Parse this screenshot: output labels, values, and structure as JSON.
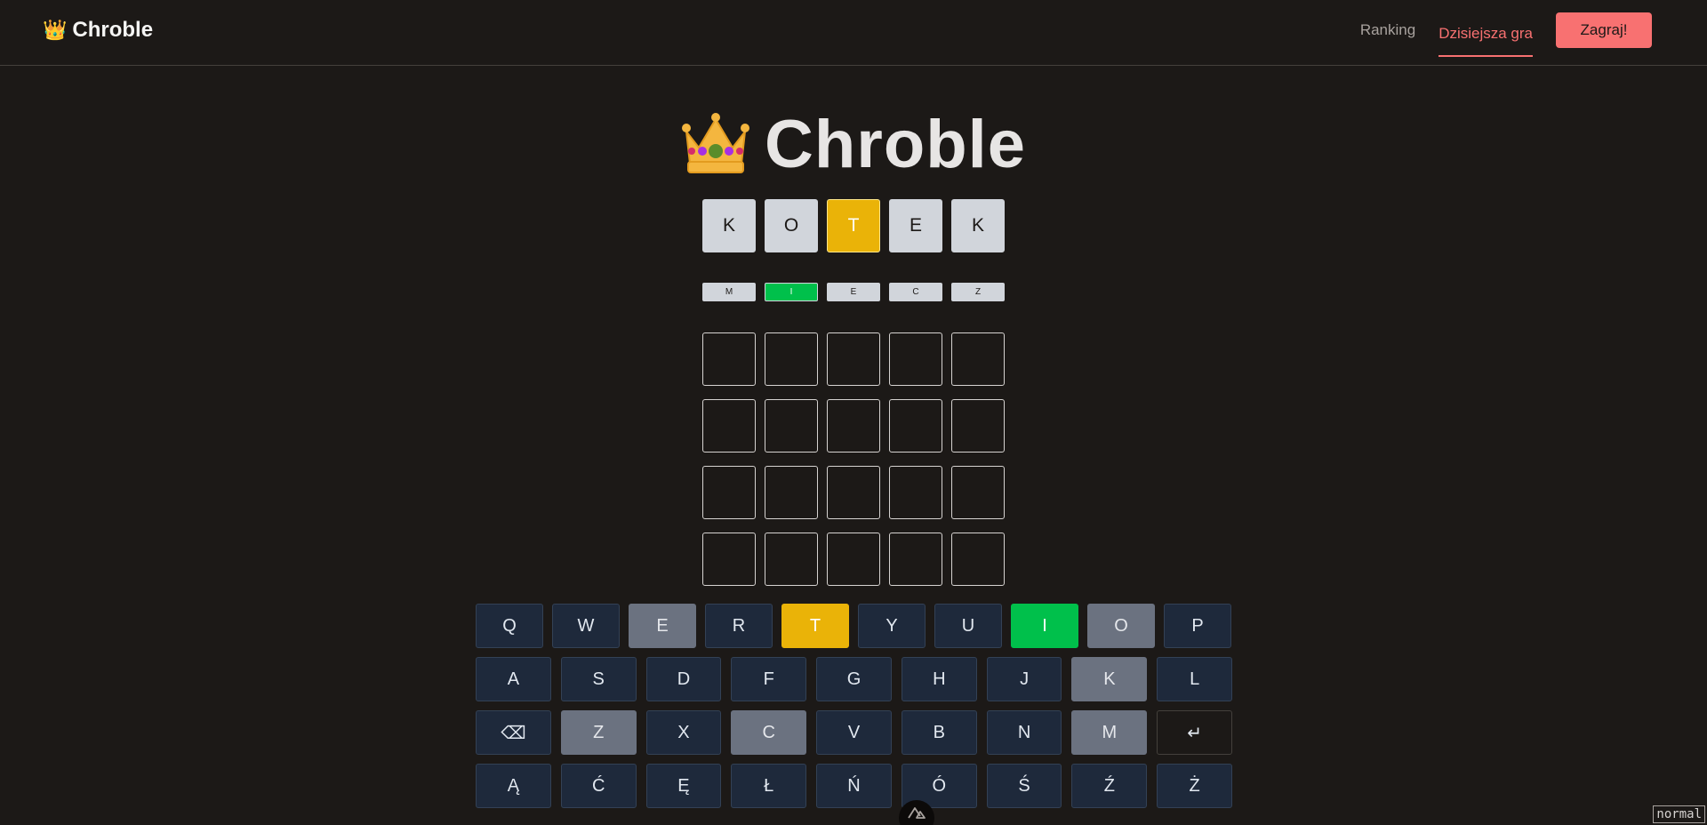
{
  "header": {
    "brand": "Chroble",
    "brand_icon": "crown-icon",
    "nav": [
      {
        "label": "Ranking",
        "active": false
      },
      {
        "label": "Dzisiejsza gra",
        "active": true
      }
    ],
    "play_button": "Zagraj!",
    "accent": "#f87171"
  },
  "title": "Chroble",
  "board": {
    "rows": [
      {
        "size": "large",
        "tiles": [
          {
            "letter": "K",
            "state": "absent"
          },
          {
            "letter": "O",
            "state": "absent"
          },
          {
            "letter": "T",
            "state": "present"
          },
          {
            "letter": "E",
            "state": "absent"
          },
          {
            "letter": "K",
            "state": "absent"
          }
        ]
      },
      {
        "size": "small",
        "tiles": [
          {
            "letter": "M",
            "state": "absent"
          },
          {
            "letter": "I",
            "state": "correct"
          },
          {
            "letter": "E",
            "state": "absent"
          },
          {
            "letter": "C",
            "state": "absent"
          },
          {
            "letter": "Z",
            "state": "absent"
          }
        ]
      },
      {
        "size": "large",
        "tiles": [
          {
            "letter": "",
            "state": "empty"
          },
          {
            "letter": "",
            "state": "empty"
          },
          {
            "letter": "",
            "state": "empty"
          },
          {
            "letter": "",
            "state": "empty"
          },
          {
            "letter": "",
            "state": "empty"
          }
        ]
      },
      {
        "size": "large",
        "tiles": [
          {
            "letter": "",
            "state": "empty"
          },
          {
            "letter": "",
            "state": "empty"
          },
          {
            "letter": "",
            "state": "empty"
          },
          {
            "letter": "",
            "state": "empty"
          },
          {
            "letter": "",
            "state": "empty"
          }
        ]
      },
      {
        "size": "large",
        "tiles": [
          {
            "letter": "",
            "state": "empty"
          },
          {
            "letter": "",
            "state": "empty"
          },
          {
            "letter": "",
            "state": "empty"
          },
          {
            "letter": "",
            "state": "empty"
          },
          {
            "letter": "",
            "state": "empty"
          }
        ]
      },
      {
        "size": "large",
        "tiles": [
          {
            "letter": "",
            "state": "empty"
          },
          {
            "letter": "",
            "state": "empty"
          },
          {
            "letter": "",
            "state": "empty"
          },
          {
            "letter": "",
            "state": "empty"
          },
          {
            "letter": "",
            "state": "empty"
          }
        ]
      }
    ],
    "colors": {
      "absent": "#d1d5db",
      "present": "#eab308",
      "correct": "#00c04b"
    }
  },
  "keyboard": {
    "rows": [
      [
        {
          "k": "Q",
          "s": ""
        },
        {
          "k": "W",
          "s": ""
        },
        {
          "k": "E",
          "s": "absent"
        },
        {
          "k": "R",
          "s": ""
        },
        {
          "k": "T",
          "s": "present"
        },
        {
          "k": "Y",
          "s": ""
        },
        {
          "k": "U",
          "s": ""
        },
        {
          "k": "I",
          "s": "correct"
        },
        {
          "k": "O",
          "s": "absent"
        },
        {
          "k": "P",
          "s": ""
        }
      ],
      [
        {
          "k": "A",
          "s": ""
        },
        {
          "k": "S",
          "s": ""
        },
        {
          "k": "D",
          "s": ""
        },
        {
          "k": "F",
          "s": ""
        },
        {
          "k": "G",
          "s": ""
        },
        {
          "k": "H",
          "s": ""
        },
        {
          "k": "J",
          "s": ""
        },
        {
          "k": "K",
          "s": "absent"
        },
        {
          "k": "L",
          "s": ""
        }
      ],
      [
        {
          "k": "⌫",
          "s": "",
          "name": "backspace"
        },
        {
          "k": "Z",
          "s": "absent"
        },
        {
          "k": "X",
          "s": ""
        },
        {
          "k": "C",
          "s": "absent"
        },
        {
          "k": "V",
          "s": ""
        },
        {
          "k": "B",
          "s": ""
        },
        {
          "k": "N",
          "s": ""
        },
        {
          "k": "M",
          "s": "absent"
        },
        {
          "k": "↵",
          "s": "enter",
          "name": "enter"
        }
      ],
      [
        {
          "k": "Ą",
          "s": ""
        },
        {
          "k": "Ć",
          "s": ""
        },
        {
          "k": "Ę",
          "s": ""
        },
        {
          "k": "Ł",
          "s": ""
        },
        {
          "k": "Ń",
          "s": ""
        },
        {
          "k": "Ó",
          "s": ""
        },
        {
          "k": "Ś",
          "s": ""
        },
        {
          "k": "Ź",
          "s": ""
        },
        {
          "k": "Ż",
          "s": ""
        }
      ]
    ]
  },
  "devtools_icon": "nuxt-devtools-icon",
  "mode_badge": "normal"
}
